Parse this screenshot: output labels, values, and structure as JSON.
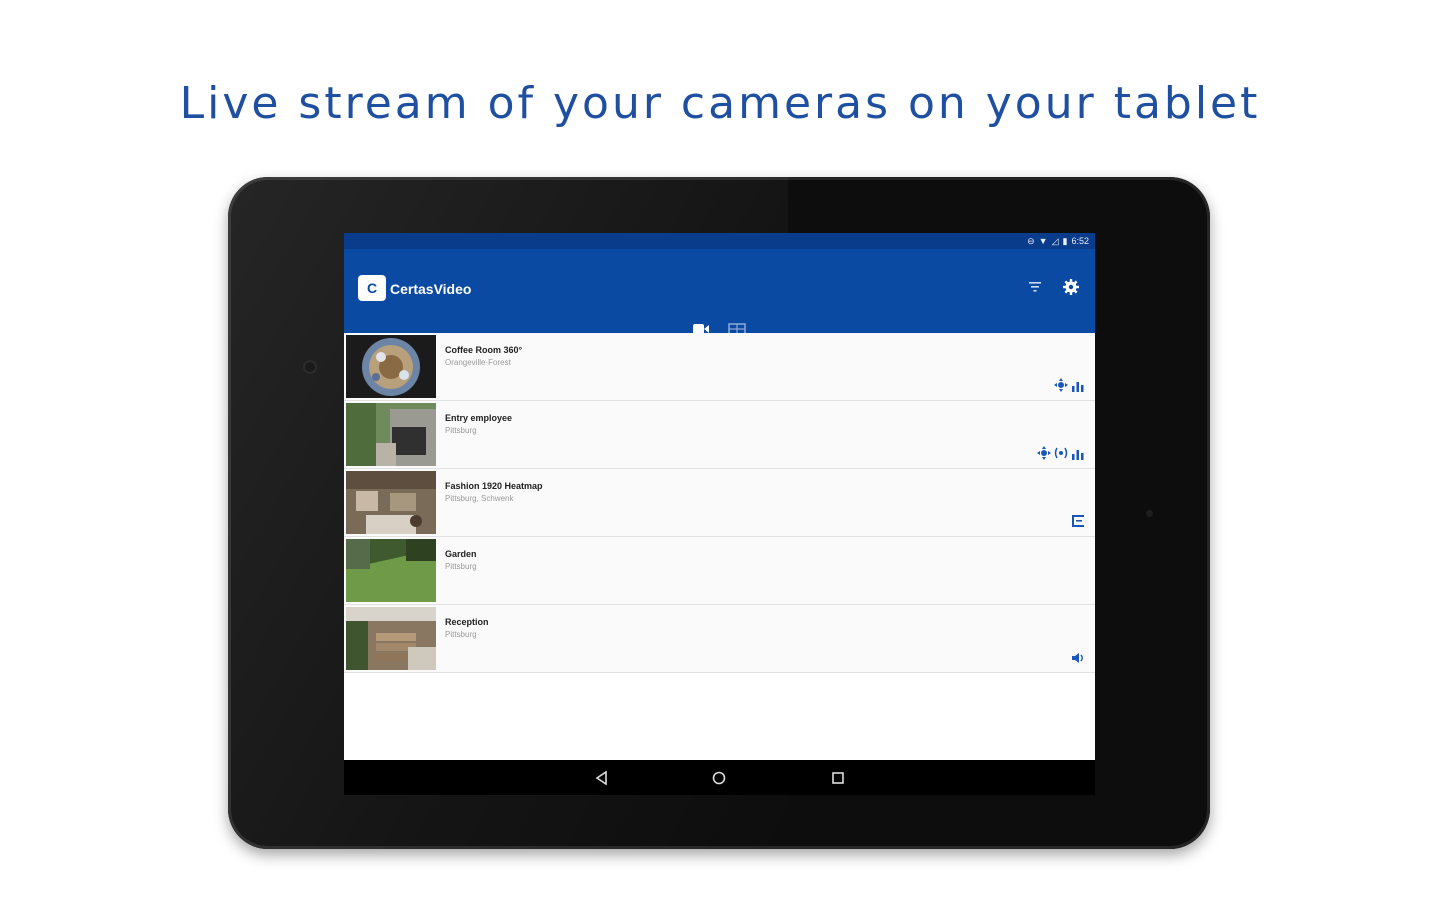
{
  "headline": "Live stream of your cameras on your tablet",
  "status_bar": {
    "time": "6:52"
  },
  "app": {
    "logo_text": "C",
    "title": "CertasVideo",
    "actions": [
      "filter-icon",
      "gear-icon"
    ],
    "tabs": [
      {
        "icon": "camera-icon",
        "selected": true
      },
      {
        "icon": "grid-icon",
        "selected": false
      }
    ]
  },
  "cameras": [
    {
      "name": "Coffee Room 360°",
      "location": "Orangeville·Forest",
      "icons": [
        "ptz-icon",
        "analytics-icon"
      ]
    },
    {
      "name": "Entry employee",
      "location": "Pittsburg",
      "icons": [
        "ptz-icon",
        "audio-wave-icon",
        "analytics-icon"
      ]
    },
    {
      "name": "Fashion 1920 Heatmap",
      "location": "Pittsburg, Schwenk",
      "icons": [
        "heatmap-icon"
      ]
    },
    {
      "name": "Garden",
      "location": "Pittsburg",
      "icons": []
    },
    {
      "name": "Reception",
      "location": "Pittsburg",
      "icons": [
        "speaker-icon"
      ]
    }
  ],
  "colors": {
    "accent": "#0b4aa2",
    "status_bar": "#0a3c8c",
    "headline": "#1f4fa0",
    "icon_blue": "#1a56b8"
  },
  "nav_bar": [
    "back-icon",
    "home-icon",
    "recent-apps-icon"
  ]
}
